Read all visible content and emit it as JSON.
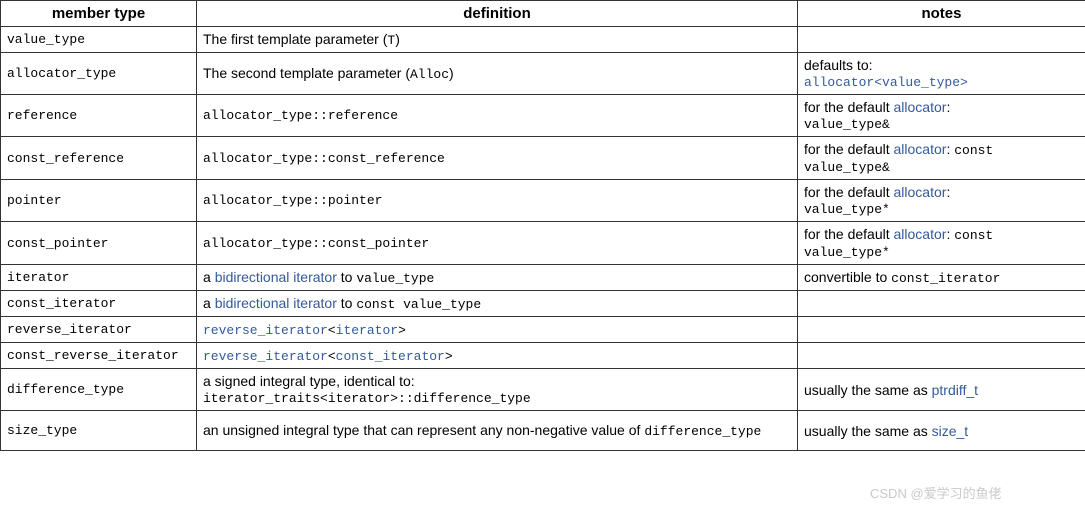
{
  "headers": {
    "member_type": "member type",
    "definition": "definition",
    "notes": "notes"
  },
  "rows": {
    "r0": {
      "name": "value_type"
    },
    "r1": {
      "name": "allocator_type"
    },
    "r2": {
      "name": "reference"
    },
    "r3": {
      "name": "const_reference"
    },
    "r4": {
      "name": "pointer"
    },
    "r5": {
      "name": "const_pointer"
    },
    "r6": {
      "name": "iterator"
    },
    "r7": {
      "name": "const_iterator"
    },
    "r8": {
      "name": "reverse_iterator"
    },
    "r9": {
      "name": "const_reverse_iterator"
    },
    "r10": {
      "name": "difference_type"
    },
    "r11": {
      "name": "size_type"
    }
  },
  "def": {
    "r0": {
      "a": "The first template parameter (",
      "b": "T",
      "c": ")"
    },
    "r1": {
      "a": "The second template parameter (",
      "b": "Alloc",
      "c": ")"
    },
    "r2": "allocator_type::reference",
    "r3": "allocator_type::const_reference",
    "r4": "allocator_type::pointer",
    "r5": "allocator_type::const_pointer",
    "r6": {
      "a": "a ",
      "b": "bidirectional iterator",
      "c": " to ",
      "d": "value_type"
    },
    "r7": {
      "a": "a ",
      "b": "bidirectional iterator",
      "c": " to ",
      "d": "const value_type"
    },
    "r8": {
      "a": "reverse_iterator",
      "b": "<",
      "c": "iterator",
      "d": ">"
    },
    "r9": {
      "a": "reverse_iterator",
      "b": "<",
      "c": "const_iterator",
      "d": ">"
    },
    "r10": {
      "a": "a signed integral type, identical to:",
      "b": "iterator_traits<iterator>::difference_type"
    },
    "r11": {
      "a": "an unsigned integral type that can represent any non-negative value of ",
      "b": "difference_type"
    }
  },
  "notes": {
    "r1": {
      "a": "defaults to:",
      "b": "allocator<value_type>"
    },
    "r2": {
      "a": "for the default ",
      "b": "allocator",
      "c": ":",
      "d": "value_type&"
    },
    "r3": {
      "a": "for the default ",
      "b": "allocator",
      "c": ": ",
      "d": "const value_type&"
    },
    "r4": {
      "a": "for the default ",
      "b": "allocator",
      "c": ":",
      "d": "value_type*"
    },
    "r5": {
      "a": "for the default ",
      "b": "allocator",
      "c": ": ",
      "d": "const value_type*"
    },
    "r6": {
      "a": "convertible to ",
      "b": "const_iterator"
    },
    "r10": {
      "a": "usually the same as ",
      "b": "ptrdiff_t"
    },
    "r11": {
      "a": "usually the same as ",
      "b": "size_t"
    }
  },
  "watermark": "CSDN @爱学习的鱼佬"
}
